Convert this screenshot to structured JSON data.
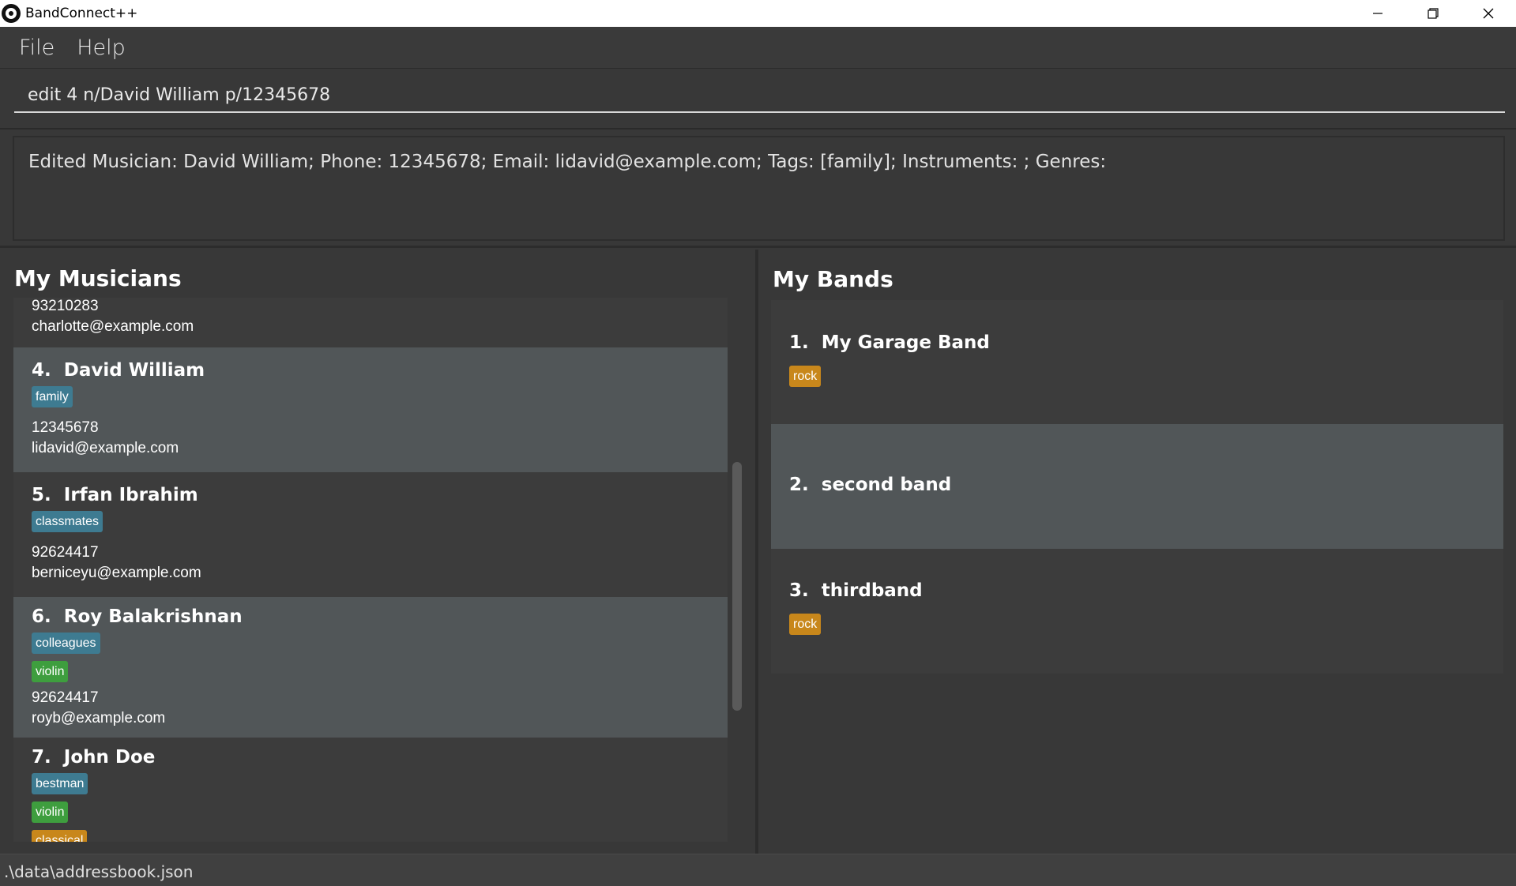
{
  "window": {
    "title": "BandConnect++"
  },
  "menu": {
    "file": "File",
    "help": "Help"
  },
  "command": {
    "value": "edit 4 n/David William p/12345678"
  },
  "result": {
    "text": "Edited Musician: David William; Phone: 12345678; Email: lidavid@example.com; Tags: [family]; Instruments: ; Genres:"
  },
  "musicians_panel": {
    "title": "My Musicians",
    "partial_top": {
      "phone": "93210283",
      "email": "charlotte@example.com"
    },
    "cards": [
      {
        "index": "4.",
        "name": "David William",
        "tags": [
          "family"
        ],
        "instruments": [],
        "genres": [],
        "phone": "12345678",
        "email": "lidavid@example.com"
      },
      {
        "index": "5.",
        "name": "Irfan Ibrahim",
        "tags": [
          "classmates"
        ],
        "instruments": [],
        "genres": [],
        "phone": "92624417",
        "email": "berniceyu@example.com"
      },
      {
        "index": "6.",
        "name": "Roy Balakrishnan",
        "tags": [
          "colleagues"
        ],
        "instruments": [
          "violin"
        ],
        "genres": [],
        "phone": "92624417",
        "email": "royb@example.com"
      },
      {
        "index": "7.",
        "name": "John Doe",
        "tags": [
          "bestman"
        ],
        "instruments": [
          "violin"
        ],
        "genres": [
          "classical"
        ],
        "phone": "",
        "email": ""
      }
    ]
  },
  "bands_panel": {
    "title": "My Bands",
    "bands": [
      {
        "index": "1.",
        "name": "My Garage Band",
        "genres": [
          "rock"
        ]
      },
      {
        "index": "2.",
        "name": "second band",
        "genres": []
      },
      {
        "index": "3.",
        "name": "thirdband",
        "genres": [
          "rock"
        ]
      }
    ]
  },
  "status": {
    "path": ".\\data\\addressbook.json"
  },
  "colors": {
    "tag": "#3e7b91",
    "instrument": "#3e9e3e",
    "genre": "#c8871b",
    "selected_card": "#515658",
    "card": "#3c3c3c"
  }
}
